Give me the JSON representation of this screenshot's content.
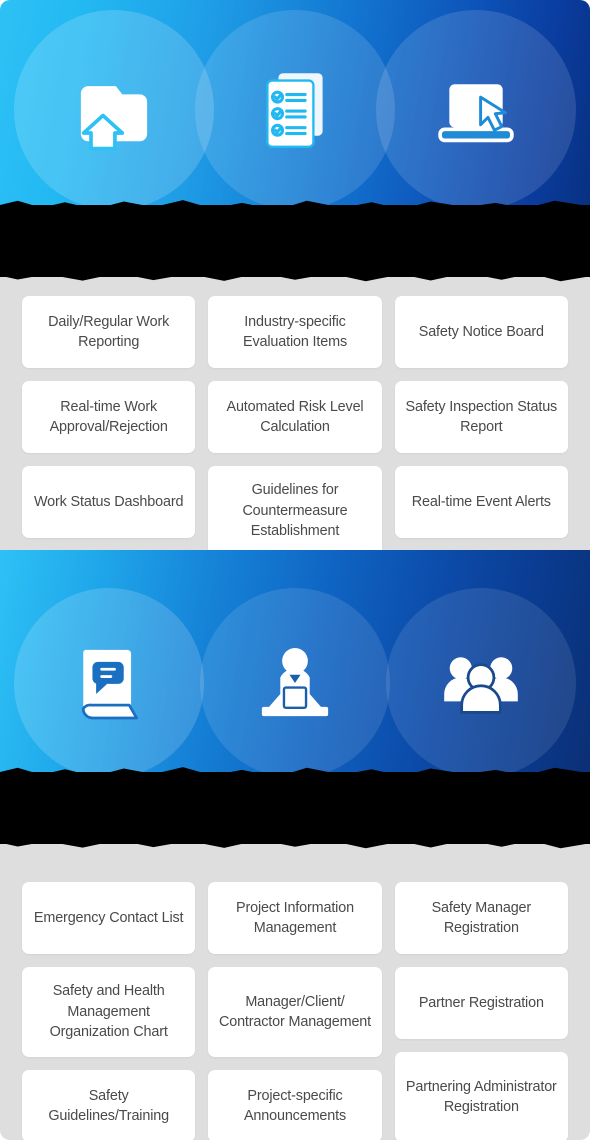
{
  "sections": [
    {
      "id": "work-management",
      "icons": [
        {
          "name": "report-folder-upload-icon",
          "label": "report-folder-upload"
        },
        {
          "name": "checklist-documents-icon",
          "label": "checklist-documents"
        },
        {
          "name": "laptop-cursor-icon",
          "label": "laptop-cursor"
        }
      ],
      "columns": [
        {
          "cards": [
            "Daily/Regular Work Reporting",
            "Real-time Work Approval/Rejection",
            "Work Status Dashboard"
          ]
        },
        {
          "cards": [
            "Industry-specific Evaluation Items",
            "Automated Risk Level Calculation",
            "Guidelines for Countermeasure Establishment"
          ]
        },
        {
          "cards": [
            "Safety Notice Board",
            "Safety Inspection Status Report",
            "Real-time Event Alerts"
          ]
        }
      ]
    },
    {
      "id": "organization-management",
      "icons": [
        {
          "name": "guidebook-speech-icon",
          "label": "guidebook-speech"
        },
        {
          "name": "person-at-desk-icon",
          "label": "person-at-desk"
        },
        {
          "name": "user-group-icon",
          "label": "user-group"
        }
      ],
      "columns": [
        {
          "cards": [
            "Emergency Contact List",
            "Safety and Health Management Organization Chart",
            "Safety Guidelines/Training"
          ]
        },
        {
          "cards": [
            "Project Information Management",
            "Manager/Client/ Contractor Management",
            "Project-specific Announcements"
          ]
        },
        {
          "cards": [
            "Safety Manager Registration",
            "Partner Registration",
            "Partnering Administrator Registration"
          ]
        }
      ]
    }
  ],
  "colors": {
    "gradient_start": "#2ec1f5",
    "gradient_end": "#08307f",
    "page_background": "#dedede",
    "card_background": "#ffffff",
    "card_text": "#4a4a4a",
    "redaction": "#000000"
  },
  "redactions": [
    {
      "name": "top-heading-redaction"
    },
    {
      "name": "bottom-heading-redaction"
    }
  ]
}
